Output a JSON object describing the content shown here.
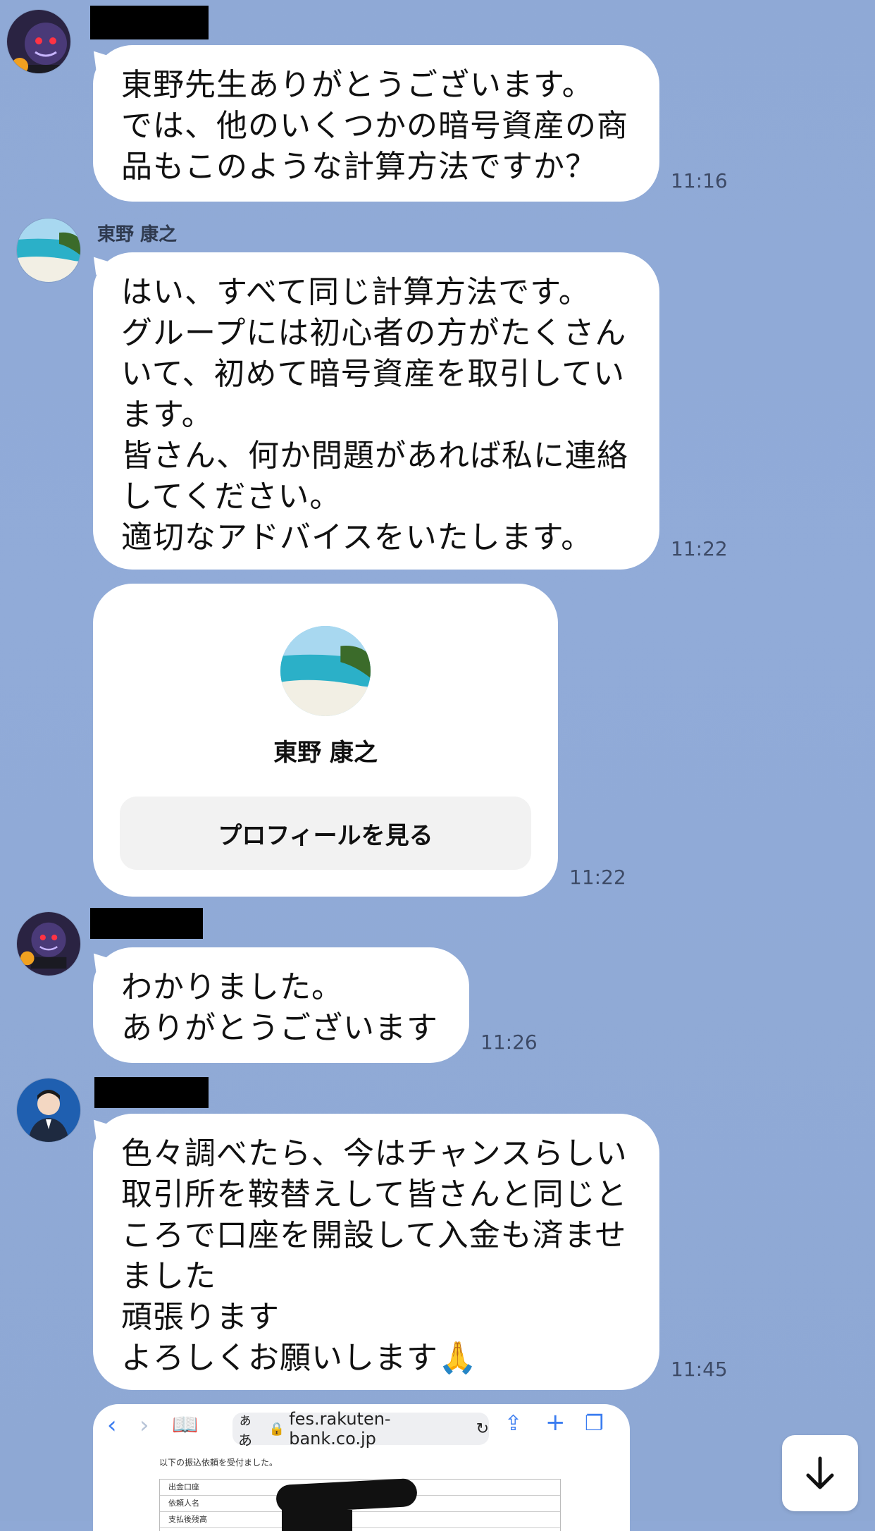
{
  "messages": [
    {
      "sender": "",
      "lines": [
        "東野先生ありがとうございます。",
        "では、他のいくつかの暗号資産の商",
        "品もこのような計算方法ですか？"
      ],
      "time": "11:16"
    },
    {
      "sender": "東野 康之",
      "lines": [
        "はい、すべて同じ計算方法です。",
        "グループには初心者の方がたくさん",
        "いて、初めて暗号資産を取引してい",
        "ます。",
        "皆さん、何か問題があれば私に連絡",
        "してください。",
        "適切なアドバイスをいたします。"
      ],
      "time": "11:22"
    },
    {
      "sender": "",
      "lines": [
        "わかりました。",
        "ありがとうございます"
      ],
      "time": "11:26"
    },
    {
      "sender": "",
      "lines": [
        "色々調べたら、今はチャンスらしい",
        "取引所を鞍替えして皆さんと同じと",
        "ころで口座を開設して入金も済ませ",
        "ました",
        "頑張ります",
        "よろしくお願いします🙏"
      ],
      "time": "11:45"
    }
  ],
  "profile_card": {
    "name": "東野 康之",
    "button_label": "プロフィールを見る",
    "time": "11:22"
  },
  "screenshot": {
    "url_prefix": "ぁあ",
    "url": "fes.rakuten-bank.co.jp",
    "doc_heading": "以下の振込依頼を受付ました。",
    "rows": [
      "出金口座",
      "依頼人名",
      "支払後残高"
    ]
  },
  "colors": {
    "background": "#8fa9d6",
    "bubble": "#ffffff",
    "time_text": "#3d4a66",
    "link_blue": "#3a7cf0"
  }
}
